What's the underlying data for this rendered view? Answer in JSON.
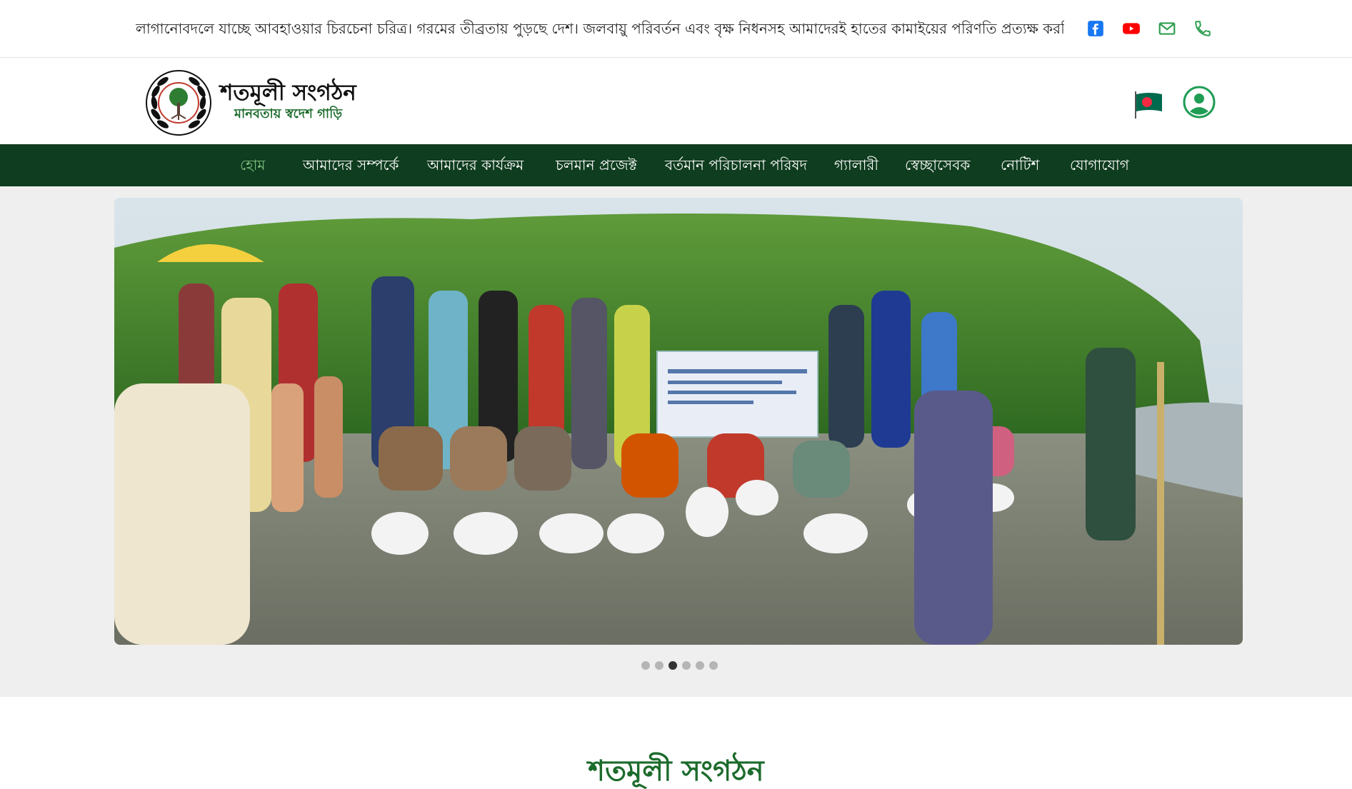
{
  "topbar": {
    "ticker_text": "লাগানোবদলে যাচ্ছে আবহাওয়ার চিরচেনা চরিত্র। গরমের তীব্রতায় পুড়ছে দেশ। জলবায়ু পরিবর্তন এবং বৃক্ষ নিধনসহ আমাদেরই হাতের কামাইয়ের পরিণতি প্রত্যক্ষ করছি আমরা",
    "social": [
      {
        "icon": "facebook-icon",
        "color": "#1877f2"
      },
      {
        "icon": "youtube-icon",
        "color": "#ff0000"
      },
      {
        "icon": "mail-icon",
        "color": "#2e9e4f"
      },
      {
        "icon": "phone-icon",
        "color": "#2e9e4f"
      }
    ]
  },
  "header": {
    "title": "শতমূলী সংগঠন",
    "tagline": "মানবতায় স্বদেশ গাড়ি",
    "flag_icon": "bangladesh-flag-icon",
    "user_icon": "user-account-icon",
    "colors": {
      "brand_green": "#1c6b2c",
      "flag_green": "#006a4e",
      "flag_red": "#f42a41"
    }
  },
  "nav": {
    "items": [
      {
        "label": "হোম",
        "active": true
      },
      {
        "label": "আমাদের সম্পর্কে",
        "active": false
      },
      {
        "label": "আমাদের কার্যক্রম",
        "active": false
      },
      {
        "label": "চলমান প্রজেক্ট",
        "active": false
      },
      {
        "label": "বর্তমান পরিচালনা পরিষদ",
        "active": false
      },
      {
        "label": "গ্যালারী",
        "active": false
      },
      {
        "label": "স্বেচ্ছাসেবক",
        "active": false
      },
      {
        "label": "নোটিশ",
        "active": false
      },
      {
        "label": "যোগাযোগ",
        "active": false
      }
    ],
    "bg_color": "#0f3d1f"
  },
  "slider": {
    "dot_count": 6,
    "active_index": 2
  },
  "section": {
    "title": "শতমূলী সংগঠন"
  }
}
